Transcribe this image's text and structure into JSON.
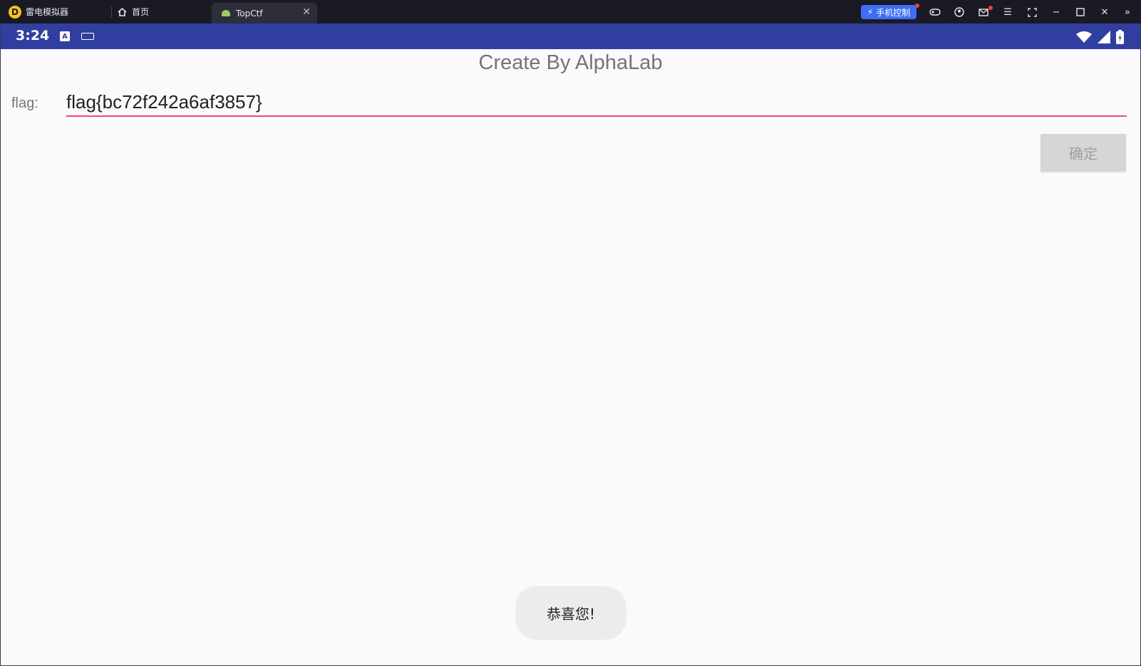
{
  "emulator": {
    "app_name": "雷电模拟器",
    "tabs": [
      {
        "label": "首页"
      },
      {
        "label": "TopCtf"
      }
    ],
    "phone_control_label": "手机控制",
    "icons": [
      "gamepad-icon",
      "user-icon",
      "mail-icon",
      "menu-icon",
      "screenshot-icon",
      "minimize-icon",
      "maximize-icon",
      "close-icon",
      "expand-icon"
    ]
  },
  "status_bar": {
    "time": "3:24",
    "badge": "A"
  },
  "app": {
    "title": "Create By AlphaLab",
    "flag_label": "flag:",
    "flag_value": "flag{bc72f242a6af3857}",
    "confirm_label": "确定"
  },
  "toast": {
    "message": "恭喜您!"
  },
  "colors": {
    "emulator_bar": "#1a1a24",
    "status_bar": "#303f9f",
    "accent": "#ff4081",
    "control_button": "#3d6ef5"
  }
}
